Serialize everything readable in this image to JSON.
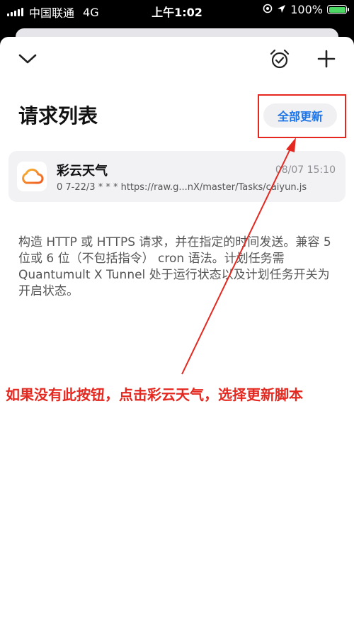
{
  "status_bar": {
    "carrier": "中国联通",
    "network": "4G",
    "time": "上午1:02",
    "battery": "100%"
  },
  "toolbar": {
    "collapse_icon": "chevron-down-icon",
    "alarm_icon": "alarm-clock-icon",
    "add_icon": "plus-icon"
  },
  "page": {
    "title": "请求列表",
    "update_all_label": "全部更新"
  },
  "task": {
    "name": "彩云天气",
    "time": "08/07 15:10",
    "cron": "0 7-22/3 * * * https://raw.g...nX/master/Tasks/caiyun.js",
    "icon": "cloud-icon"
  },
  "description": "构造 HTTP 或 HTTPS 请求，并在指定的时间发送。兼容 5 位或 6 位（不包括指令） cron 语法。计划任务需 Quantumult X Tunnel 处于运行状态以及计划任务开关为开启状态。",
  "annotation": "如果没有此按钮，点击彩云天气，选择更新脚本",
  "colors": {
    "accent": "#1a73e8",
    "annotation_red": "#e5281f",
    "battery_green": "#4cd964"
  }
}
